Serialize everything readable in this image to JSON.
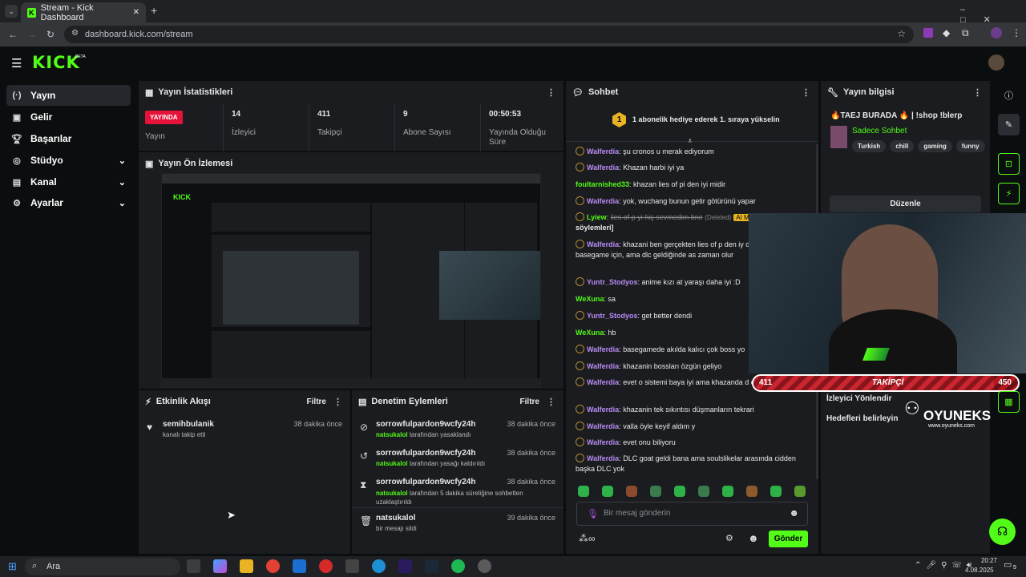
{
  "browser": {
    "tab_title": "Stream - Kick Dashboard",
    "url": "dashboard.kick.com/stream"
  },
  "app": {
    "logo": "KICK",
    "beta": "BETA"
  },
  "sidebar": {
    "items": [
      {
        "label": "Yayın",
        "icon": "broadcast-icon"
      },
      {
        "label": "Gelir",
        "icon": "revenue-icon"
      },
      {
        "label": "Başarılar",
        "icon": "trophy-icon"
      },
      {
        "label": "Stüdyo",
        "icon": "studio-icon"
      },
      {
        "label": "Kanal",
        "icon": "channel-icon"
      },
      {
        "label": "Ayarlar",
        "icon": "gear-icon"
      }
    ]
  },
  "stats": {
    "title": "Yayın İstatistikleri",
    "live_badge": "YAYINDA",
    "live_label": "Yayın",
    "items": [
      {
        "value": "14",
        "label": "İzleyici"
      },
      {
        "value": "411",
        "label": "Takipçi"
      },
      {
        "value": "9",
        "label": "Abone Sayısı"
      },
      {
        "value": "00:50:53",
        "label": "Yayında Olduğu Süre"
      }
    ]
  },
  "preview": {
    "title": "Yayın Ön İzlemesi"
  },
  "activity": {
    "title": "Etkinlik Akışı",
    "filter": "Filtre",
    "items": [
      {
        "user": "semihbulanik",
        "desc": "kanalı takip etti",
        "time": "38 dakika önce"
      }
    ]
  },
  "moderation": {
    "title": "Denetim Eylemleri",
    "filter": "Filtre",
    "items": [
      {
        "user": "sorrowfulpardon9wcfy24h",
        "by": "natsukalol",
        "desc": "tarafından yasaklandı",
        "time": "38 dakika önce"
      },
      {
        "user": "sorrowfulpardon9wcfy24h",
        "by": "natsukalol",
        "desc": "tarafından yasağı kaldırıldı",
        "time": "38 dakika önce"
      },
      {
        "user": "sorrowfulpardon9wcfy24h",
        "by": "natsukalol",
        "desc": "tarafından 5 dakika süreliğine sohbetten uzaklaştırıldı",
        "time": "38 dakika önce"
      },
      {
        "user": "natsukalol",
        "by": "",
        "desc": "bir mesajı sildi",
        "time": "39 dakika önce"
      }
    ]
  },
  "chat": {
    "title": "Sohbet",
    "pinned": "1 abonelik hediye ederek 1. sıraya yükselin",
    "pinned_rank": "1",
    "messages": [
      {
        "user": "Walferdia",
        "text": "şu cronos u merak ediyorum"
      },
      {
        "user": "Walferdia",
        "text": "Khazan harbi iyi ya"
      },
      {
        "user": "foultarnished33",
        "text": "khazan lies of pi den iyi midir"
      },
      {
        "user": "Walferdia",
        "text": "yok, wuchang bunun getir götürünü yapar"
      },
      {
        "user": "Lyiew",
        "text": "lies of p yi hiç sevmedim bne",
        "deleted": "(Deleted)",
        "tag": "AI M",
        "tail": "söylemleri]"
      },
      {
        "user": "Walferdia",
        "text": "khazani ben gerçekten lies of p den iy düşünüyorum basegame için, ama dlc geldiğinde as zaman olur"
      },
      {
        "user": "Yuntr_Stodyos",
        "text": "anime kızı at yaraşı daha iyi :D"
      },
      {
        "user": "WeXuna",
        "text": "sa"
      },
      {
        "user": "Yuntr_Stodyos",
        "text": "get better dendi"
      },
      {
        "user": "WeXuna",
        "text": "hb"
      },
      {
        "user": "Walferdia",
        "text": "basegamede akılda kalıcı çok boss yo"
      },
      {
        "user": "Walferdia",
        "text": "khazanin bossları özgün geliyo"
      },
      {
        "user": "Walferdia",
        "text": "evet o sistemi baya iyi ama khazanda d çeşitlilik va"
      },
      {
        "user": "Walferdia",
        "text": "khazanin tek sıkıntısı düşmanların tekrari"
      },
      {
        "user": "Walferdia",
        "text": "valla öyle keyif aldım y"
      },
      {
        "user": "Walferdia",
        "text": "evet onu biliyoru"
      },
      {
        "user": "Walferdia",
        "text": "DLC goat geldi bana ama soulslikelar arasında cidden başka DLC yok"
      }
    ],
    "input_placeholder": "Bir mesaj gönderin",
    "send": "Gönder"
  },
  "info": {
    "title": "Yayın bilgisi",
    "stream_title": "🔥TAEJ BURADA 🔥 | !shop !blerp",
    "category": "Sadece Sohbet",
    "tags": [
      "Turkish",
      "chill",
      "gaming",
      "funny"
    ],
    "edit": "Düzenle",
    "goal1": "İzleyici Yönlendir",
    "goal2": "Hedefleri belirleyin"
  },
  "overlay": {
    "left": "411",
    "mid": "TAKİPÇİ",
    "right": "450",
    "progress": 0.91,
    "brand": "OYUNEKS",
    "site": "www.oyuneks.com"
  },
  "taskbar": {
    "search": "Ara",
    "time": "20:27",
    "date": "4.08.2025",
    "notif": "5"
  },
  "colors": {
    "accent": "#53fc18",
    "live": "#e5133a"
  }
}
